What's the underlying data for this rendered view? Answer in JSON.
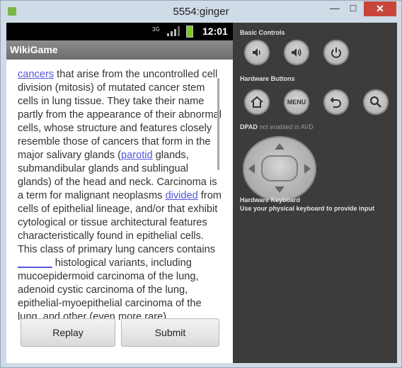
{
  "window": {
    "title": "5554:ginger"
  },
  "device": {
    "status": {
      "network": "3G",
      "clock": "12:01"
    },
    "app_title": "WikiGame",
    "article": {
      "t0_link": "cancers",
      "t1": " that arise from the uncontrolled cell division (mitosis) of mutated cancer stem cells in lung tissue. They take their name partly from the appearance of their abnormal cells, whose structure and features closely resemble those of cancers that form in the major salivary glands (",
      "t2_link": "parotid",
      "t3": " glands, submandibular glands and sublingual glands) of the head and neck. Carcinoma is a term for malignant neoplasms ",
      "t4_link": "divided",
      "t5": " from cells of epithelial lineage, and/or that exhibit cytological or tissue architectural features characteristically found in epithelial cells. This class of primary lung cancers contains ",
      "t6_blank": "______",
      "t7": " histological variants, including mucoepidermoid carcinoma of the lung, adenoid cystic carcinoma of the lung, epithelial-myoepithelial carcinoma of the lung, and other (even more rare)"
    },
    "buttons": {
      "replay": "Replay",
      "submit": "Submit"
    }
  },
  "panel": {
    "basic_controls": "Basic Controls",
    "hardware_buttons": "Hardware Buttons",
    "menu_label": "MENU",
    "dpad_label": "DPAD",
    "dpad_note": "not enabled in AVD",
    "keyboard_title": "Hardware Keyboard",
    "keyboard_note": "Use your physical keyboard to provide input"
  },
  "icons": [
    "volume-down-icon",
    "volume-up-icon",
    "power-icon",
    "home-icon",
    "menu-icon",
    "back-icon",
    "search-icon"
  ]
}
